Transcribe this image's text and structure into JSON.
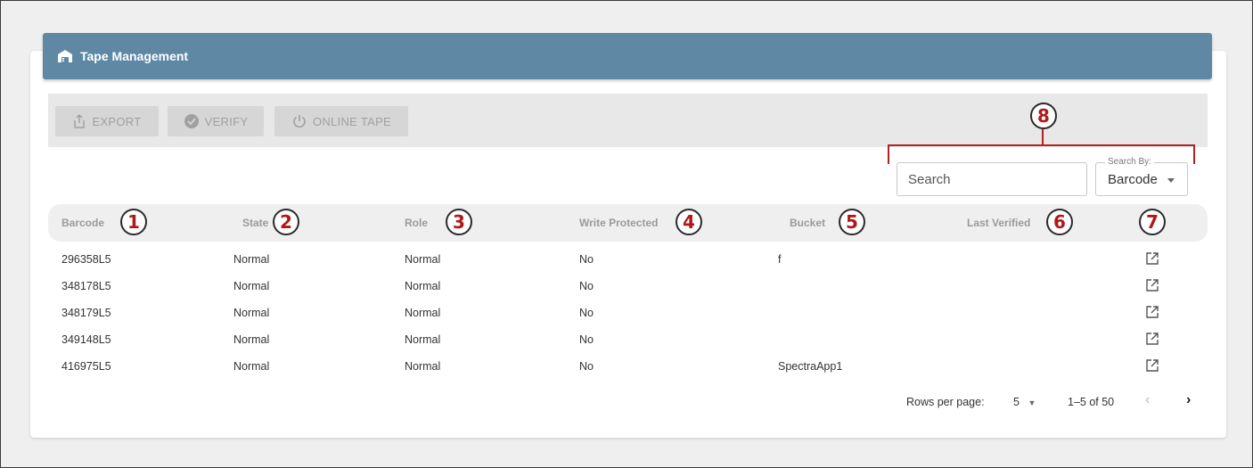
{
  "header": {
    "title": "Tape Management",
    "icon": "warehouse-icon"
  },
  "toolbar": {
    "export_label": "EXPORT",
    "verify_label": "VERIFY",
    "online_label": "ONLINE TAPE"
  },
  "search": {
    "placeholder": "Search",
    "by_label": "Search By:",
    "by_value": "Barcode"
  },
  "columns": {
    "barcode": "Barcode",
    "state": "State",
    "role": "Role",
    "write_protected": "Write Protected",
    "bucket": "Bucket",
    "last_verified": "Last Verified"
  },
  "rows": [
    {
      "barcode": "296358L5",
      "state": "Normal",
      "role": "Normal",
      "write_protected": "No",
      "bucket": "f",
      "last_verified": ""
    },
    {
      "barcode": "348178L5",
      "state": "Normal",
      "role": "Normal",
      "write_protected": "No",
      "bucket": "",
      "last_verified": ""
    },
    {
      "barcode": "348179L5",
      "state": "Normal",
      "role": "Normal",
      "write_protected": "No",
      "bucket": "",
      "last_verified": ""
    },
    {
      "barcode": "349148L5",
      "state": "Normal",
      "role": "Normal",
      "write_protected": "No",
      "bucket": "",
      "last_verified": ""
    },
    {
      "barcode": "416975L5",
      "state": "Normal",
      "role": "Normal",
      "write_protected": "No",
      "bucket": "SpectraApp1",
      "last_verified": ""
    }
  ],
  "pagination": {
    "rows_label": "Rows per page:",
    "rows_value": "5",
    "range": "1–5 of 50"
  },
  "callouts": [
    "1",
    "2",
    "3",
    "4",
    "5",
    "6",
    "7",
    "8"
  ],
  "colors": {
    "header": "#5e88a4",
    "callout": "#b01818"
  }
}
